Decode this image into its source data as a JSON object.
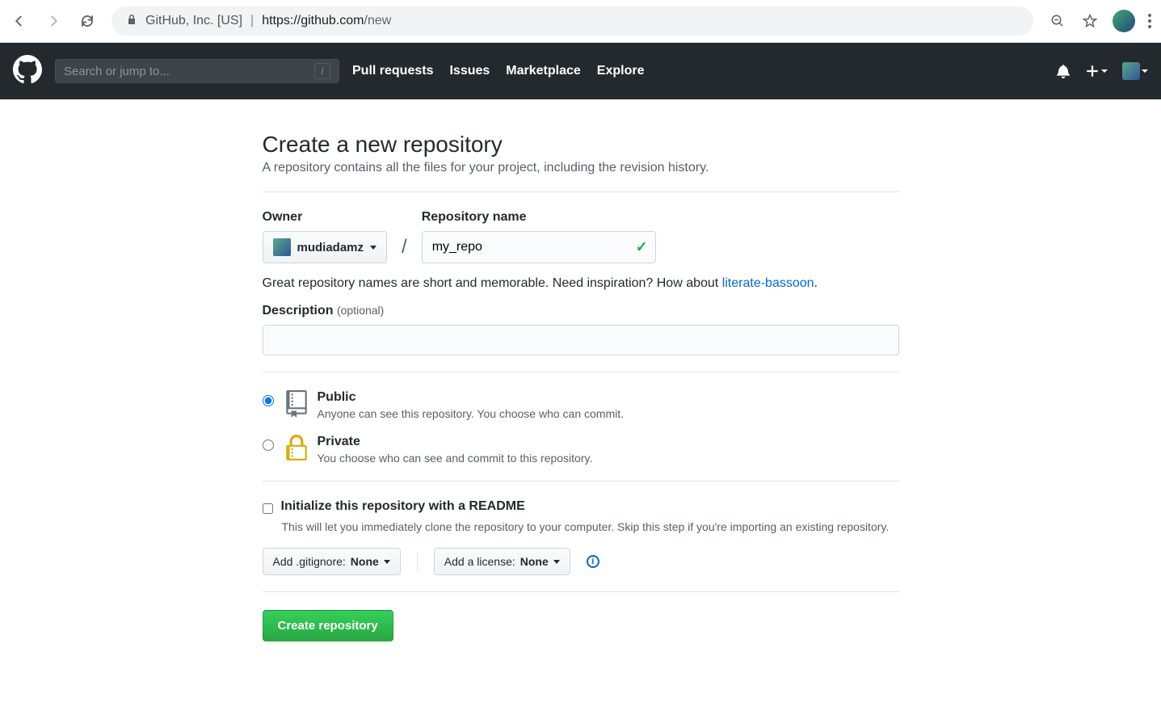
{
  "browser": {
    "secure_label": "GitHub, Inc. [US]",
    "url_display": "https://github.com",
    "url_path": "/new"
  },
  "header": {
    "search_placeholder": "Search or jump to...",
    "search_key": "/",
    "nav": {
      "pull_requests": "Pull requests",
      "issues": "Issues",
      "marketplace": "Marketplace",
      "explore": "Explore"
    }
  },
  "form": {
    "title": "Create a new repository",
    "subtitle": "A repository contains all the files for your project, including the revision history.",
    "owner_label": "Owner",
    "owner_value": "mudiadamz",
    "slash": "/",
    "repo_label": "Repository name",
    "repo_value": "my_repo",
    "hint_prefix": "Great repository names are short and memorable. Need inspiration? How about ",
    "hint_suggestion": "literate-bassoon",
    "hint_suffix": ".",
    "desc_label": "Description",
    "desc_optional": "(optional)",
    "desc_value": "",
    "public_label": "Public",
    "public_desc": "Anyone can see this repository. You choose who can commit.",
    "private_label": "Private",
    "private_desc": "You choose who can see and commit to this repository.",
    "init_label": "Initialize this repository with a README",
    "init_desc": "This will let you immediately clone the repository to your computer. Skip this step if you're importing an existing repository.",
    "gitignore_prefix": "Add .gitignore: ",
    "gitignore_value": "None",
    "license_prefix": "Add a license: ",
    "license_value": "None",
    "submit_label": "Create repository"
  }
}
